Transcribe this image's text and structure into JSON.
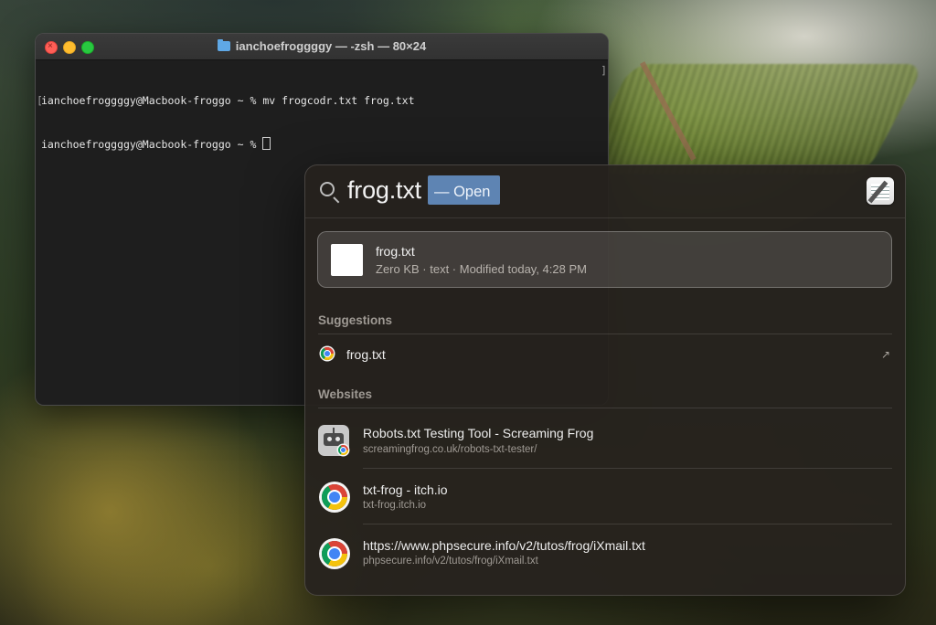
{
  "terminal": {
    "title": "ianchoefroggggy — -zsh — 80×24",
    "lines": [
      "ianchoefroggggy@Macbook-froggo ~ % mv frogcodr.txt frog.txt",
      "ianchoefroggggy@Macbook-froggo ~ % "
    ]
  },
  "spotlight": {
    "query": "frog.txt",
    "action_label": "— Open",
    "top_hit": {
      "name": "frog.txt",
      "meta": "Zero KB · text · Modified today, 4:28 PM"
    },
    "suggestions_label": "Suggestions",
    "suggestions": [
      {
        "title": "frog.txt",
        "icon": "chrome-icon",
        "action_icon": "↗"
      }
    ],
    "websites_label": "Websites",
    "websites": [
      {
        "title": "Robots.txt Testing Tool - Screaming Frog",
        "url": "screamingfrog.co.uk/robots-txt-tester/",
        "icon": "robot-icon"
      },
      {
        "title": "txt-frog - itch.io",
        "url": "txt-frog.itch.io",
        "icon": "chrome-icon"
      },
      {
        "title": "https://www.phpsecure.info/v2/tutos/frog/iXmail.txt",
        "url": "phpsecure.info/v2/tutos/frog/iXmail.txt",
        "icon": "chrome-icon"
      }
    ]
  },
  "colors": {
    "open_chip": "#5e84b3",
    "terminal_bg": "#1e1e1e",
    "panel_bg": "#26221e"
  }
}
